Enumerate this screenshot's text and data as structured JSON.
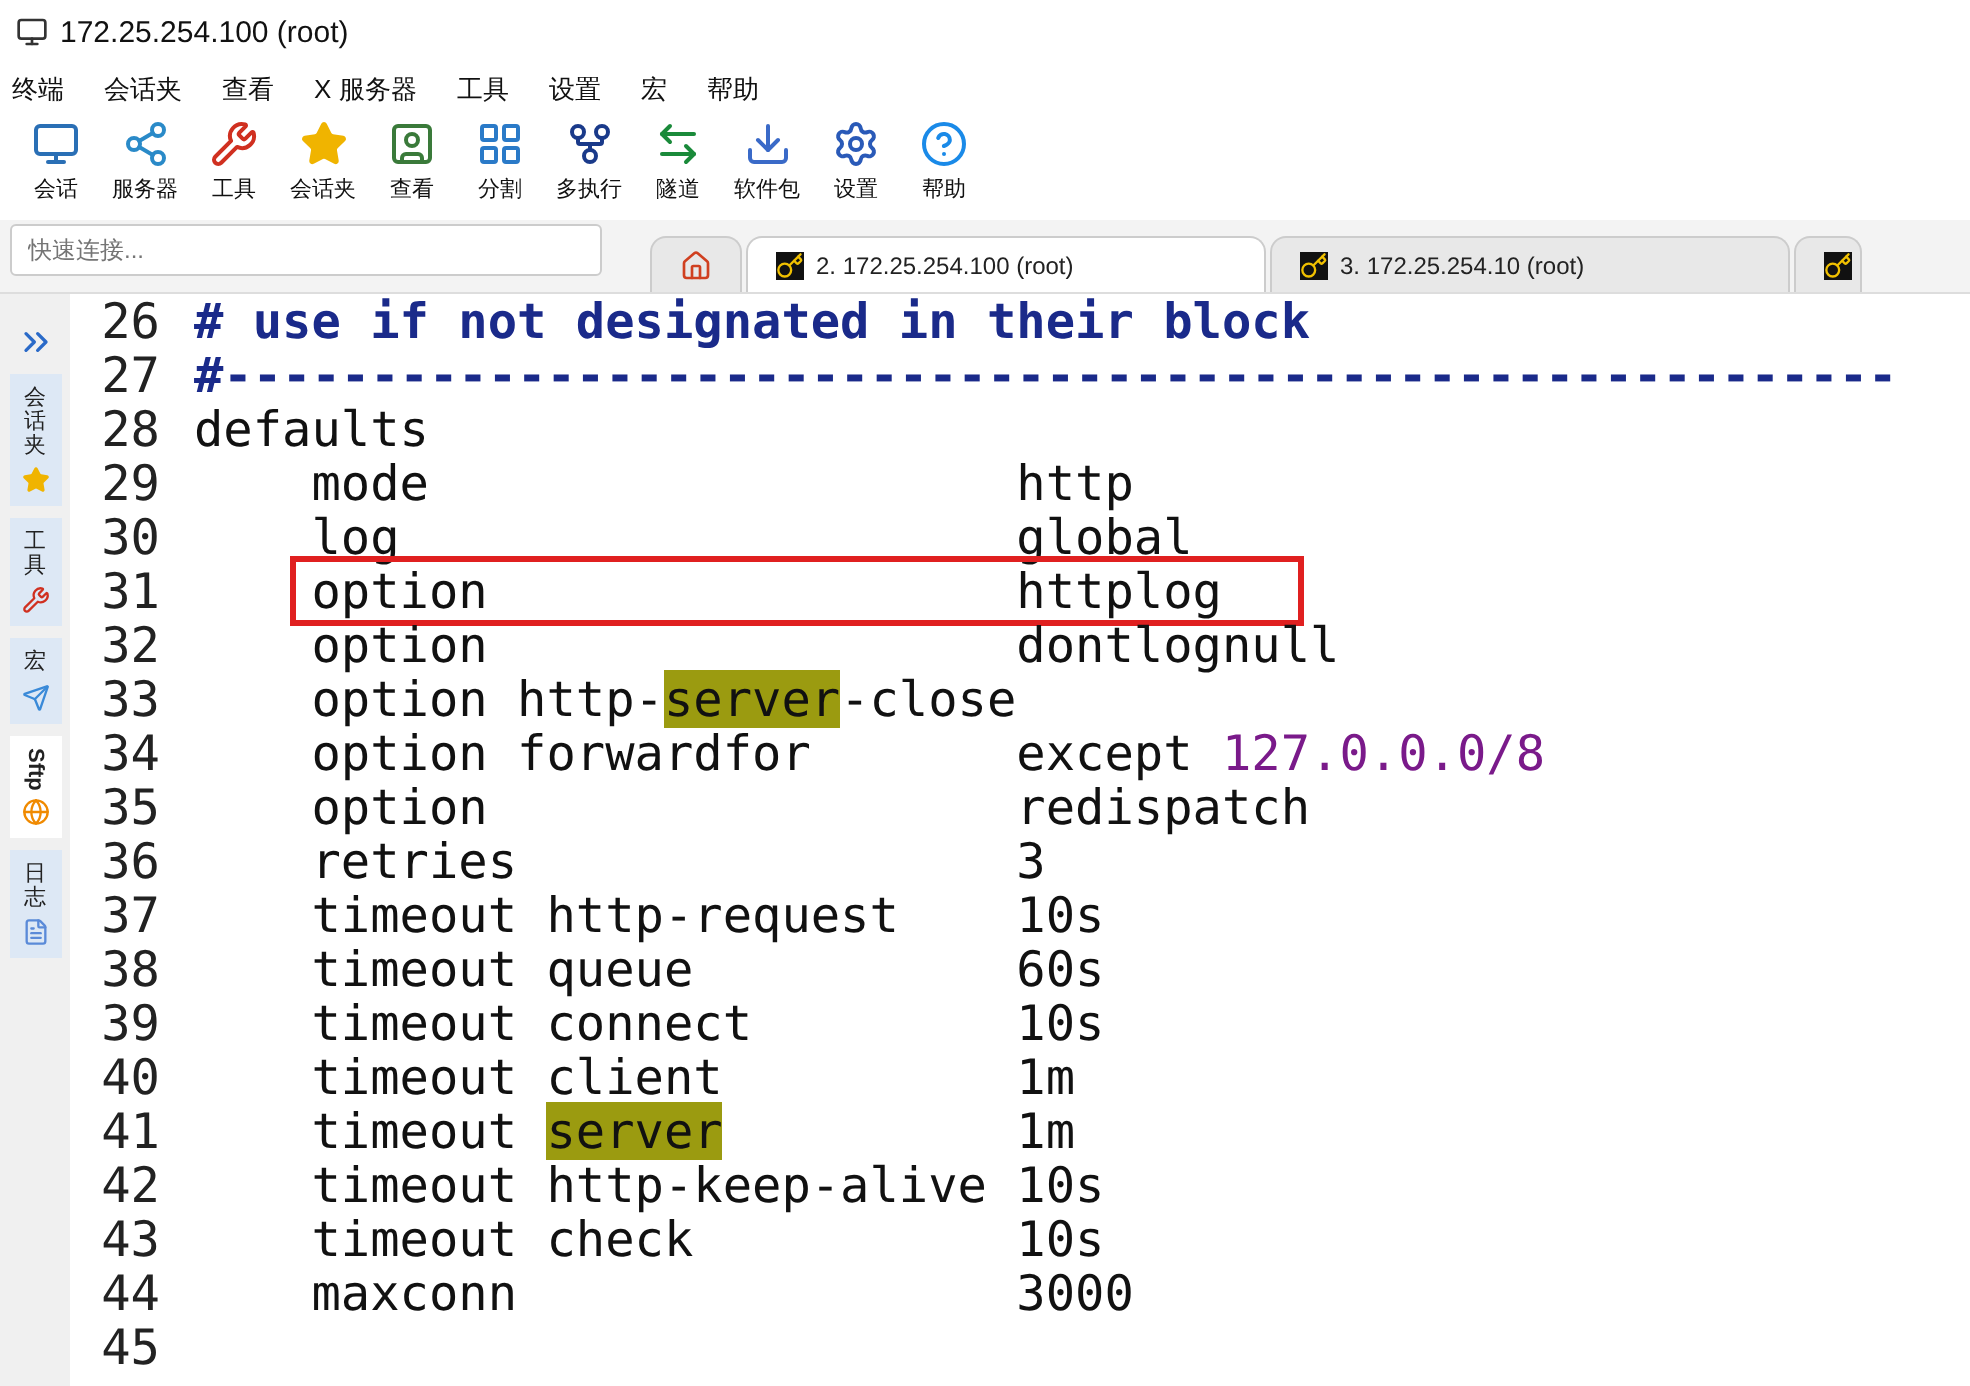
{
  "window": {
    "title": "172.25.254.100 (root)"
  },
  "menu": [
    "终端",
    "会话夹",
    "查看",
    "X 服务器",
    "工具",
    "设置",
    "宏",
    "帮助"
  ],
  "toolbar": [
    {
      "kind": "session",
      "label": "会话"
    },
    {
      "kind": "servers",
      "label": "服务器"
    },
    {
      "kind": "tools",
      "label": "工具"
    },
    {
      "kind": "star",
      "label": "会话夹"
    },
    {
      "kind": "view",
      "label": "查看"
    },
    {
      "kind": "split",
      "label": "分割"
    },
    {
      "kind": "multi",
      "label": "多执行"
    },
    {
      "kind": "tunnel",
      "label": "隧道"
    },
    {
      "kind": "package",
      "label": "软件包"
    },
    {
      "kind": "settings",
      "label": "设置"
    },
    {
      "kind": "help",
      "label": "帮助"
    }
  ],
  "quick_connect": {
    "placeholder": "快速连接..."
  },
  "tabs": [
    {
      "label": "2. 172.25.254.100 (root)",
      "selected": true
    },
    {
      "label": "3. 172.25.254.10 (root)",
      "selected": false
    },
    {
      "selected": false
    }
  ],
  "side_tabs": [
    {
      "kind": "star",
      "label": "会话夹",
      "selected": false
    },
    {
      "kind": "tools",
      "label": "工具",
      "selected": false
    },
    {
      "kind": "macro",
      "label": "宏",
      "selected": false
    },
    {
      "kind": "sftp",
      "label": "Sftp",
      "selected": true
    },
    {
      "kind": "log",
      "label": "日志",
      "selected": false
    }
  ],
  "editor": {
    "lines": [
      {
        "number": "26",
        "selected": false,
        "parts": [
          {
            "kind": "comment",
            "text": "# use if not designated in their block"
          }
        ]
      },
      {
        "number": "27",
        "selected": false,
        "parts": [
          {
            "kind": "comment",
            "text": "#---------------------------------------------------------"
          }
        ]
      },
      {
        "number": "28",
        "selected": false,
        "parts": [
          {
            "kind": "plain",
            "text": "defaults"
          }
        ]
      },
      {
        "number": "29",
        "selected": false,
        "parts": [
          {
            "kind": "plain",
            "text": "    mode                    http"
          }
        ]
      },
      {
        "number": "30",
        "selected": false,
        "parts": [
          {
            "kind": "plain",
            "text": "    log                     global"
          }
        ]
      },
      {
        "number": "31",
        "selected": true,
        "parts": [
          {
            "kind": "plain",
            "text": "    option                  httplog"
          }
        ]
      },
      {
        "number": "32",
        "selected": false,
        "parts": [
          {
            "kind": "plain",
            "text": "    option                  dontlognull"
          }
        ]
      },
      {
        "number": "33",
        "selected": false,
        "parts": [
          {
            "kind": "plain",
            "text": "    option http-"
          },
          {
            "kind": "match",
            "text": "server"
          },
          {
            "kind": "plain",
            "text": "-close"
          }
        ]
      },
      {
        "number": "34",
        "selected": false,
        "parts": [
          {
            "kind": "plain",
            "text": "    option forwardfor       except "
          },
          {
            "kind": "number",
            "text": "127.0.0.0/8"
          }
        ]
      },
      {
        "number": "35",
        "selected": false,
        "parts": [
          {
            "kind": "plain",
            "text": "    option                  redispatch"
          }
        ]
      },
      {
        "number": "36",
        "selected": false,
        "parts": [
          {
            "kind": "plain",
            "text": "    retries                 3"
          }
        ]
      },
      {
        "number": "37",
        "selected": false,
        "parts": [
          {
            "kind": "plain",
            "text": "    timeout http-request    10s"
          }
        ]
      },
      {
        "number": "38",
        "selected": false,
        "parts": [
          {
            "kind": "plain",
            "text": "    timeout queue           60s"
          }
        ]
      },
      {
        "number": "39",
        "selected": false,
        "parts": [
          {
            "kind": "plain",
            "text": "    timeout connect         10s"
          }
        ]
      },
      {
        "number": "40",
        "selected": false,
        "parts": [
          {
            "kind": "plain",
            "text": "    timeout client          1m"
          }
        ]
      },
      {
        "number": "41",
        "selected": false,
        "parts": [
          {
            "kind": "plain",
            "text": "    timeout "
          },
          {
            "kind": "match",
            "text": "server"
          },
          {
            "kind": "plain",
            "text": "          1m"
          }
        ]
      },
      {
        "number": "42",
        "selected": false,
        "parts": [
          {
            "kind": "plain",
            "text": "    timeout http-keep-alive 10s"
          }
        ]
      },
      {
        "number": "43",
        "selected": false,
        "parts": [
          {
            "kind": "plain",
            "text": "    timeout check           10s"
          }
        ]
      },
      {
        "number": "44",
        "selected": false,
        "parts": [
          {
            "kind": "plain",
            "text": "    maxconn                 3000"
          }
        ]
      },
      {
        "number": "45",
        "selected": false
      }
    ]
  }
}
